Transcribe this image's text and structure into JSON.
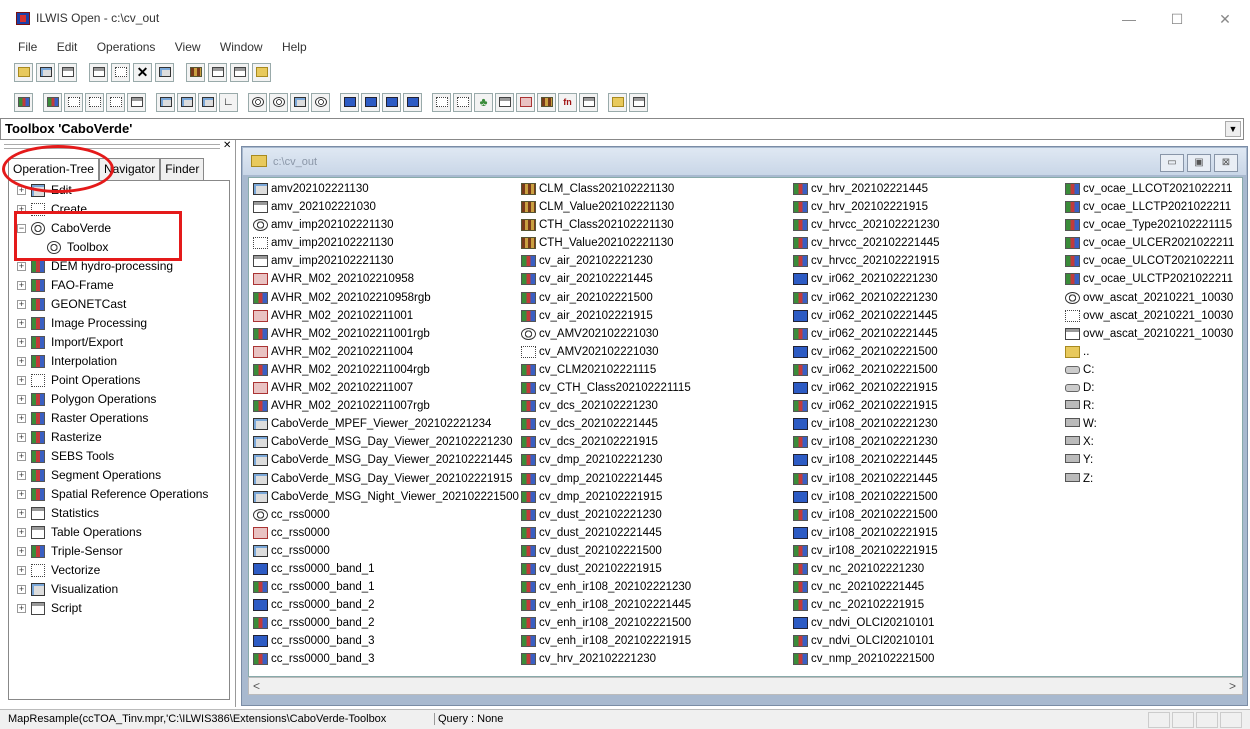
{
  "window": {
    "title": "ILWIS Open - c:\\cv_out",
    "minimize": "—",
    "maximize": "☐",
    "close": "✕"
  },
  "menu": [
    "File",
    "Edit",
    "Operations",
    "View",
    "Window",
    "Help"
  ],
  "combo": {
    "value": "Toolbox 'CaboVerde'",
    "arrow": "▼"
  },
  "panel": {
    "close": "✕",
    "tabs": [
      "Operation-Tree",
      "Navigator",
      "Finder"
    ],
    "tree": [
      {
        "label": "Edit",
        "icon": "edit-icon",
        "expander": "+"
      },
      {
        "label": "Create",
        "icon": "create-icon",
        "expander": "+"
      },
      {
        "label": "CaboVerde",
        "icon": "globe-icon",
        "expander": "−"
      },
      {
        "label": "Toolbox",
        "icon": "globe-icon",
        "child": true
      },
      {
        "label": "DEM hydro-processing",
        "icon": "raster-icon",
        "expander": "+"
      },
      {
        "label": "FAO-Frame",
        "icon": "fao-icon",
        "expander": "+"
      },
      {
        "label": "GEONETCast",
        "icon": "geonetcast-icon",
        "expander": "+"
      },
      {
        "label": "Image Processing",
        "icon": "raster-icon",
        "expander": "+"
      },
      {
        "label": "Import/Export",
        "icon": "raster-icon",
        "expander": "+"
      },
      {
        "label": "Interpolation",
        "icon": "raster-icon",
        "expander": "+"
      },
      {
        "label": "Point Operations",
        "icon": "point-icon",
        "expander": "+"
      },
      {
        "label": "Polygon Operations",
        "icon": "raster-icon",
        "expander": "+"
      },
      {
        "label": "Raster Operations",
        "icon": "raster-icon",
        "expander": "+"
      },
      {
        "label": "Rasterize",
        "icon": "raster-icon",
        "expander": "+"
      },
      {
        "label": "SEBS Tools",
        "icon": "raster-icon",
        "expander": "+"
      },
      {
        "label": "Segment Operations",
        "icon": "segment-icon",
        "expander": "+"
      },
      {
        "label": "Spatial Reference Operations",
        "icon": "georef-icon",
        "expander": "+"
      },
      {
        "label": "Statistics",
        "icon": "table-icon",
        "expander": "+"
      },
      {
        "label": "Table Operations",
        "icon": "table-icon",
        "expander": "+"
      },
      {
        "label": "Triple-Sensor",
        "icon": "palm-icon",
        "expander": "+"
      },
      {
        "label": "Vectorize",
        "icon": "vector-icon",
        "expander": "+"
      },
      {
        "label": "Visualization",
        "icon": "view-icon",
        "expander": "+"
      },
      {
        "label": "Script",
        "icon": "script-icon",
        "expander": "+"
      }
    ]
  },
  "catalog": {
    "caption": "c:\\cv_out",
    "buttons": [
      "▭",
      "▣",
      "⊠"
    ],
    "columns": [
      [
        {
          "name": "amv202102221130",
          "icon": "view"
        },
        {
          "name": "amv_202102221030",
          "icon": "table"
        },
        {
          "name": "amv_imp202102221130",
          "icon": "globe"
        },
        {
          "name": "amv_imp202102221130",
          "icon": "pt"
        },
        {
          "name": "amv_imp202102221130",
          "icon": "table"
        },
        {
          "name": "AVHR_M02_202102210958",
          "icon": "mpl"
        },
        {
          "name": "AVHR_M02_202102210958rgb",
          "icon": "raster"
        },
        {
          "name": "AVHR_M02_202102211001",
          "icon": "mpl"
        },
        {
          "name": "AVHR_M02_202102211001rgb",
          "icon": "raster"
        },
        {
          "name": "AVHR_M02_202102211004",
          "icon": "mpl"
        },
        {
          "name": "AVHR_M02_202102211004rgb",
          "icon": "raster"
        },
        {
          "name": "AVHR_M02_202102211007",
          "icon": "mpl"
        },
        {
          "name": "AVHR_M02_202102211007rgb",
          "icon": "raster"
        },
        {
          "name": "CaboVerde_MPEF_Viewer_202102221234",
          "icon": "view"
        },
        {
          "name": "CaboVerde_MSG_Day_Viewer_202102221230",
          "icon": "view"
        },
        {
          "name": "CaboVerde_MSG_Day_Viewer_202102221445",
          "icon": "view"
        },
        {
          "name": "CaboVerde_MSG_Day_Viewer_202102221915",
          "icon": "view"
        },
        {
          "name": "CaboVerde_MSG_Night_Viewer_202102221500",
          "icon": "view"
        },
        {
          "name": "cc_rss0000",
          "icon": "globe"
        },
        {
          "name": "cc_rss0000",
          "icon": "mpl"
        },
        {
          "name": "cc_rss0000",
          "icon": "view"
        },
        {
          "name": "cc_rss0000_band_1",
          "icon": "map"
        },
        {
          "name": "cc_rss0000_band_1",
          "icon": "raster"
        },
        {
          "name": "cc_rss0000_band_2",
          "icon": "map"
        },
        {
          "name": "cc_rss0000_band_2",
          "icon": "raster"
        },
        {
          "name": "cc_rss0000_band_3",
          "icon": "map"
        },
        {
          "name": "cc_rss0000_band_3",
          "icon": "raster"
        }
      ],
      [
        {
          "name": "CLM_Class202102221130",
          "icon": "class"
        },
        {
          "name": "CLM_Value202102221130",
          "icon": "class"
        },
        {
          "name": "CTH_Class202102221130",
          "icon": "class"
        },
        {
          "name": "CTH_Value202102221130",
          "icon": "class"
        },
        {
          "name": "cv_air_202102221230",
          "icon": "raster"
        },
        {
          "name": "cv_air_202102221445",
          "icon": "raster"
        },
        {
          "name": "cv_air_202102221500",
          "icon": "raster"
        },
        {
          "name": "cv_air_202102221915",
          "icon": "raster"
        },
        {
          "name": "cv_AMV202102221030",
          "icon": "globe"
        },
        {
          "name": "cv_AMV202102221030",
          "icon": "pt"
        },
        {
          "name": "cv_CLM202102221115",
          "icon": "raster"
        },
        {
          "name": "cv_CTH_Class202102221115",
          "icon": "raster"
        },
        {
          "name": "cv_dcs_202102221230",
          "icon": "raster"
        },
        {
          "name": "cv_dcs_202102221445",
          "icon": "raster"
        },
        {
          "name": "cv_dcs_202102221915",
          "icon": "raster"
        },
        {
          "name": "cv_dmp_202102221230",
          "icon": "raster"
        },
        {
          "name": "cv_dmp_202102221445",
          "icon": "raster"
        },
        {
          "name": "cv_dmp_202102221915",
          "icon": "raster"
        },
        {
          "name": "cv_dust_202102221230",
          "icon": "raster"
        },
        {
          "name": "cv_dust_202102221445",
          "icon": "raster"
        },
        {
          "name": "cv_dust_202102221500",
          "icon": "raster"
        },
        {
          "name": "cv_dust_202102221915",
          "icon": "raster"
        },
        {
          "name": "cv_enh_ir108_202102221230",
          "icon": "raster"
        },
        {
          "name": "cv_enh_ir108_202102221445",
          "icon": "raster"
        },
        {
          "name": "cv_enh_ir108_202102221500",
          "icon": "raster"
        },
        {
          "name": "cv_enh_ir108_202102221915",
          "icon": "raster"
        },
        {
          "name": "cv_hrv_202102221230",
          "icon": "raster"
        }
      ],
      [
        {
          "name": "cv_hrv_202102221445",
          "icon": "raster"
        },
        {
          "name": "cv_hrv_202102221915",
          "icon": "raster"
        },
        {
          "name": "cv_hrvcc_202102221230",
          "icon": "raster"
        },
        {
          "name": "cv_hrvcc_202102221445",
          "icon": "raster"
        },
        {
          "name": "cv_hrvcc_202102221915",
          "icon": "raster"
        },
        {
          "name": "cv_ir062_202102221230",
          "icon": "map"
        },
        {
          "name": "cv_ir062_202102221230",
          "icon": "raster"
        },
        {
          "name": "cv_ir062_202102221445",
          "icon": "map"
        },
        {
          "name": "cv_ir062_202102221445",
          "icon": "raster"
        },
        {
          "name": "cv_ir062_202102221500",
          "icon": "map"
        },
        {
          "name": "cv_ir062_202102221500",
          "icon": "raster"
        },
        {
          "name": "cv_ir062_202102221915",
          "icon": "map"
        },
        {
          "name": "cv_ir062_202102221915",
          "icon": "raster"
        },
        {
          "name": "cv_ir108_202102221230",
          "icon": "map"
        },
        {
          "name": "cv_ir108_202102221230",
          "icon": "raster"
        },
        {
          "name": "cv_ir108_202102221445",
          "icon": "map"
        },
        {
          "name": "cv_ir108_202102221445",
          "icon": "raster"
        },
        {
          "name": "cv_ir108_202102221500",
          "icon": "map"
        },
        {
          "name": "cv_ir108_202102221500",
          "icon": "raster"
        },
        {
          "name": "cv_ir108_202102221915",
          "icon": "map"
        },
        {
          "name": "cv_ir108_202102221915",
          "icon": "raster"
        },
        {
          "name": "cv_nc_202102221230",
          "icon": "raster"
        },
        {
          "name": "cv_nc_202102221445",
          "icon": "raster"
        },
        {
          "name": "cv_nc_202102221915",
          "icon": "raster"
        },
        {
          "name": "cv_ndvi_OLCI20210101",
          "icon": "map"
        },
        {
          "name": "cv_ndvi_OLCI20210101",
          "icon": "raster"
        },
        {
          "name": "cv_nmp_202102221500",
          "icon": "raster"
        }
      ],
      [
        {
          "name": "cv_ocae_LLCOT2021022211",
          "icon": "raster"
        },
        {
          "name": "cv_ocae_LLCTP2021022211",
          "icon": "raster"
        },
        {
          "name": "cv_ocae_Type202102221115",
          "icon": "raster"
        },
        {
          "name": "cv_ocae_ULCER2021022211",
          "icon": "raster"
        },
        {
          "name": "cv_ocae_ULCOT2021022211",
          "icon": "raster"
        },
        {
          "name": "cv_ocae_ULCTP2021022211",
          "icon": "raster"
        },
        {
          "name": "ovw_ascat_20210221_10030",
          "icon": "globe"
        },
        {
          "name": "ovw_ascat_20210221_10030",
          "icon": "pt"
        },
        {
          "name": "ovw_ascat_20210221_10030",
          "icon": "table"
        },
        {
          "name": "..",
          "icon": "folder"
        },
        {
          "name": "C:",
          "icon": "drive"
        },
        {
          "name": "D:",
          "icon": "drive"
        },
        {
          "name": "R:",
          "icon": "net"
        },
        {
          "name": "W:",
          "icon": "net"
        },
        {
          "name": "X:",
          "icon": "net"
        },
        {
          "name": "Y:",
          "icon": "net"
        },
        {
          "name": "Z:",
          "icon": "net"
        }
      ]
    ],
    "scroll_left": "<",
    "scroll_right": ">"
  },
  "status": {
    "command": "MapResample(ccTOA_Tinv.mpr,'C:\\ILWIS386\\Extensions\\CaboVerde-Toolbox",
    "query": "Query : None"
  },
  "colors": {
    "annotation": "#e41a1a",
    "mdi_background": "#a8b9cf"
  }
}
